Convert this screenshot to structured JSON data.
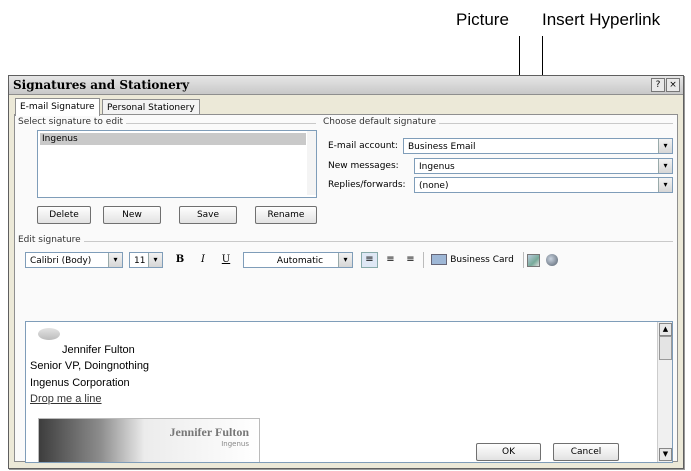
{
  "callouts": {
    "picture": "Picture",
    "insert_hyperlink": "Insert Hyperlink"
  },
  "dialog": {
    "title": "Signatures and Stationery",
    "help_btn": "?",
    "close_btn": "×",
    "tabs": [
      {
        "label": "E-mail Signature"
      },
      {
        "label": "Personal Stationery"
      }
    ],
    "select_label": "Select signature to edit",
    "signatures": [
      "Ingenus"
    ],
    "buttons": {
      "delete": "Delete",
      "new": "New",
      "save": "Save",
      "rename": "Rename"
    },
    "default_label": "Choose default signature",
    "email_account_label": "E-mail account:",
    "email_account_value": "Business Email",
    "new_messages_label": "New messages:",
    "new_messages_value": "Ingenus",
    "replies_label": "Replies/forwards:",
    "replies_value": "(none)",
    "edit_label": "Edit signature",
    "toolbar": {
      "font": "Calibri (Body)",
      "size": "11",
      "bold": "B",
      "italic": "I",
      "underline": "U",
      "color": "Automatic",
      "business_card": "Business Card"
    },
    "signature": {
      "name": "Jennifer Fulton",
      "title": "Senior VP, Doingnothing",
      "company": "Ingenus Corporation",
      "link": "Drop me a line",
      "card_name": "Jennifer Fulton",
      "card_company": "Ingenus"
    },
    "ok": "OK",
    "cancel": "Cancel"
  }
}
